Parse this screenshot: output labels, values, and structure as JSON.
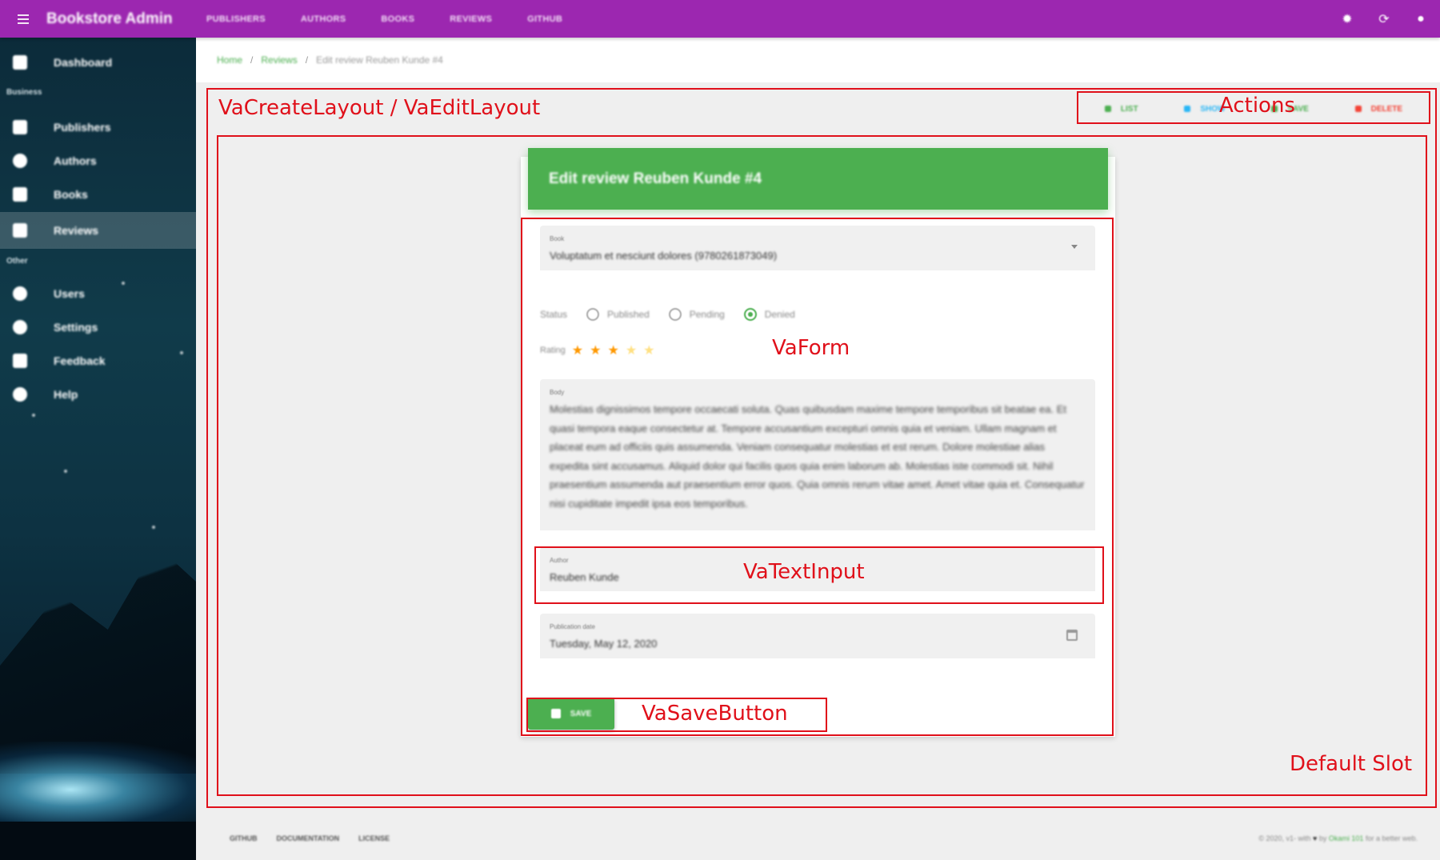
{
  "appbar": {
    "title": "Bookstore Admin",
    "nav": [
      "PUBLISHERS",
      "AUTHORS",
      "BOOKS",
      "REVIEWS",
      "GITHUB"
    ],
    "icons": [
      "sun-icon",
      "refresh-icon",
      "account-icon"
    ]
  },
  "sidebar": {
    "items_top": [
      {
        "label": "Dashboard",
        "icon": "dashboard-icon"
      }
    ],
    "section_business": "Business",
    "items_business": [
      {
        "label": "Publishers",
        "icon": "publishers-icon"
      },
      {
        "label": "Authors",
        "icon": "authors-icon"
      },
      {
        "label": "Books",
        "icon": "books-icon"
      },
      {
        "label": "Reviews",
        "icon": "reviews-icon",
        "active": true
      }
    ],
    "section_other": "Other",
    "items_other": [
      {
        "label": "Users",
        "icon": "users-icon"
      },
      {
        "label": "Settings",
        "icon": "settings-icon"
      },
      {
        "label": "Feedback",
        "icon": "feedback-icon"
      },
      {
        "label": "Help",
        "icon": "help-icon"
      }
    ]
  },
  "breadcrumb": {
    "home": "Home",
    "section": "Reviews",
    "current": "Edit review Reuben Kunde #4"
  },
  "annotations": {
    "layout": "VaCreateLayout / VaEditLayout",
    "actions": "Actions",
    "default_slot": "Default Slot",
    "form": "VaForm",
    "text_input": "VaTextInput",
    "save_button": "VaSaveButton"
  },
  "actions": {
    "list": "LIST",
    "show": "SHOW",
    "save": "SAVE",
    "delete": "DELETE"
  },
  "form": {
    "title": "Edit review Reuben Kunde #4",
    "book_label": "Book",
    "book_value": "Voluptatum et nesciunt dolores (9780261873049)",
    "status_label": "Status",
    "status_options": [
      "Published",
      "Pending",
      "Denied"
    ],
    "status_selected": "Denied",
    "rating_label": "Rating",
    "rating_value": 3,
    "rating_max": 5,
    "body_label": "Body",
    "body_value": "Molestias dignissimos tempore occaecati soluta. Quas quibusdam maxime tempore temporibus sit beatae ea. Et quasi tempora eaque consectetur at. Tempore accusantium excepturi omnis quia et veniam. Ullam magnam et placeat eum ad officiis quis assumenda. Veniam consequatur molestias et est rerum. Dolore molestiae alias expedita sint accusamus. Aliquid dolor qui facilis quos quia enim laborum ab. Molestias iste commodi sit. Nihil praesentium assumenda aut praesentium error quos. Quia omnis rerum vitae amet. Amet vitae quia et. Consequatur nisi cupiditate impedit ipsa eos temporibus.",
    "author_label": "Author",
    "author_value": "Reuben Kunde",
    "date_label": "Publication date",
    "date_value": "Tuesday, May 12, 2020",
    "save_label": "SAVE"
  },
  "footer": {
    "links": [
      "GITHUB",
      "DOCUMENTATION",
      "LICENSE"
    ],
    "copy_prefix": "© 2020, v1- with",
    "copy_by": "by",
    "copy_author": "Okami 101",
    "copy_suffix": "for a better web."
  },
  "colors": {
    "appbar": "#9c27b0",
    "accent": "#4caf50",
    "annotation": "#e0101a"
  }
}
